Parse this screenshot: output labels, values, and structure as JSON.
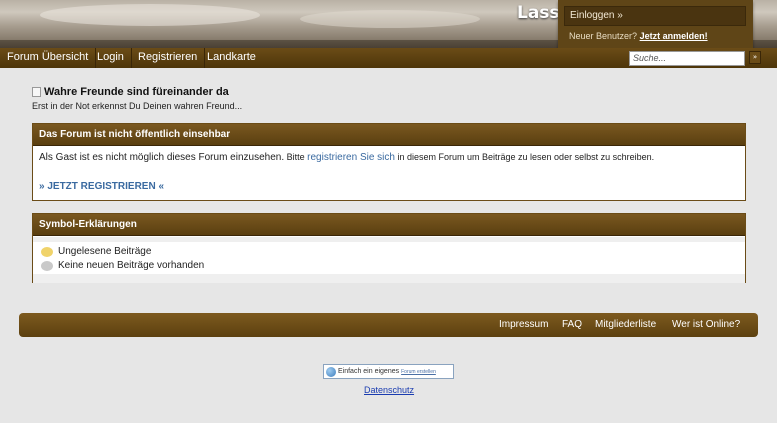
{
  "header": {
    "site_title": "Lasst"
  },
  "login": {
    "button_label": "Einloggen »",
    "new_user_text": "Neuer Benutzer?",
    "register_link": "Jetzt anmelden!"
  },
  "nav": {
    "items": [
      {
        "label": "Forum Übersicht"
      },
      {
        "label": "Login"
      },
      {
        "label": "Registrieren"
      },
      {
        "label": "Landkarte"
      }
    ]
  },
  "search": {
    "placeholder": "Suche...",
    "button_label": "»"
  },
  "forum": {
    "title": "Wahre Freunde sind füreinander da",
    "subtitle": "Erst in der Not erkennst Du Deinen wahren Freund..."
  },
  "notice": {
    "heading": "Das Forum ist nicht öffentlich einsehbar",
    "text_part1": "Als Gast ist es nicht möglich dieses Forum einzusehen.",
    "text_part2": "Bitte",
    "link_text": "registrieren Sie sich",
    "text_part3": "in diesem Forum um Beiträge zu lesen oder selbst zu schreiben.",
    "register_now": "» JETZT REGISTRIEREN «"
  },
  "legend": {
    "heading": "Symbol-Erklärungen",
    "items": [
      {
        "label": "Ungelesene Beiträge",
        "icon": "unread-bubble-icon",
        "color": "#f0d36a"
      },
      {
        "label": "Keine neuen Beiträge vorhanden",
        "icon": "read-bubble-icon",
        "color": "#c9c9c9"
      }
    ]
  },
  "footer": {
    "links": [
      {
        "label": "Impressum"
      },
      {
        "label": "FAQ"
      },
      {
        "label": "Mitgliederliste"
      },
      {
        "label": "Wer ist Online?"
      }
    ]
  },
  "badge": {
    "text": "Einfach ein eigenes",
    "link": "Forum erstellen"
  },
  "privacy": {
    "label": "Datenschutz"
  },
  "colors": {
    "nav_brown": "#5a3f10",
    "link_blue": "#3a6aa0",
    "background": "#e6e6e6"
  }
}
